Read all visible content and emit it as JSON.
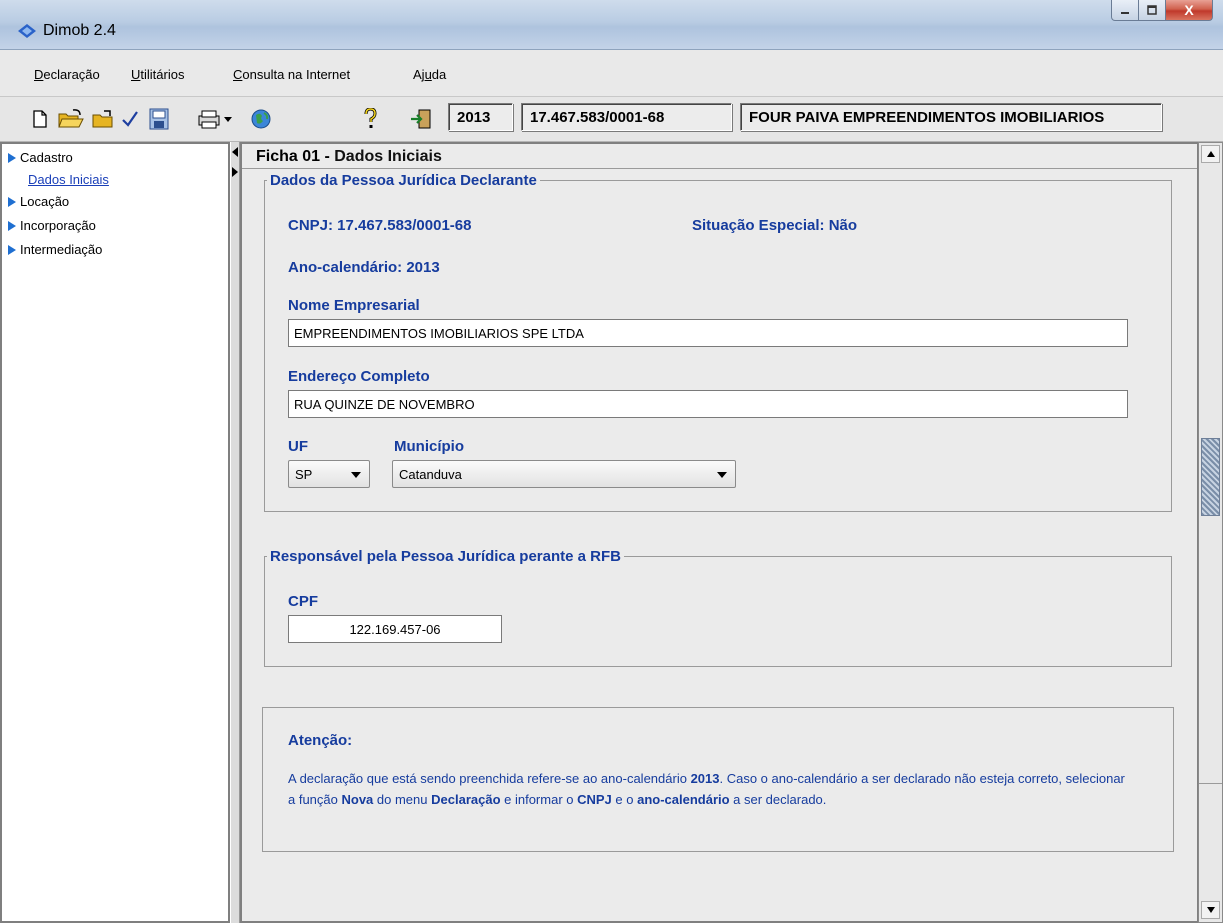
{
  "window": {
    "title": "Dimob 2.4",
    "close_glyph": "X"
  },
  "menu": {
    "items": [
      {
        "underline": "D",
        "rest": "eclaração"
      },
      {
        "underline": "U",
        "rest": "tilitários"
      },
      {
        "underline": "C",
        "rest": "onsulta na Internet"
      },
      {
        "underline": "",
        "rest": "Aj",
        "underline_mid": "u",
        "rest2": "da"
      }
    ]
  },
  "toolbar": {
    "icons": [
      "new-icon",
      "open-folder-icon",
      "open-icon",
      "check-icon",
      "save-icon",
      "printer-icon",
      "globe-icon",
      "help-icon",
      "exit-icon"
    ],
    "year": "2013",
    "cnpj": "17.467.583/0001-68",
    "company": "FOUR PAIVA EMPREENDIMENTOS IMOBILIARIOS"
  },
  "sidebar": {
    "items": [
      {
        "label": "Cadastro"
      },
      {
        "label": "Dados Iniciais"
      },
      {
        "label": "Locação"
      },
      {
        "label": "Incorporação"
      },
      {
        "label": "Intermediação"
      }
    ]
  },
  "ficha": {
    "title_prefix": "Ficha 01",
    "title_sep": " - ",
    "title_name": "Dados Iniciais"
  },
  "declarante": {
    "legend": "Dados da Pessoa Jurídica Declarante",
    "cnpj_label": "CNPJ: 17.467.583/0001-68",
    "situacao_label": "Situação Especial: Não",
    "ano_label": "Ano-calendário: 2013",
    "nome_label": "Nome Empresarial",
    "nome_value": "EMPREENDIMENTOS IMOBILIARIOS SPE LTDA",
    "endereco_label": "Endereço Completo",
    "endereco_value": "RUA QUINZE DE NOVEMBRO",
    "uf_label": "UF",
    "uf_value": "SP",
    "municipio_label": "Município",
    "municipio_value": "Catanduva"
  },
  "responsavel": {
    "legend": "Responsável pela Pessoa Jurídica perante a RFB",
    "cpf_label": "CPF",
    "cpf_value": "122.169.457-06"
  },
  "atencao": {
    "title": "Atenção:",
    "t1": "A declaração que está sendo preenchida refere-se ao ano-calendário ",
    "b1": "2013",
    "t2": ". Caso o ano-calendário a ser declarado não esteja correto, selecionar a função ",
    "b2": "Nova",
    "t3": " do menu ",
    "b3": "Declaração",
    "t4": " e informar o ",
    "b4": "CNPJ",
    "t5": " e o ",
    "b5": "ano-calendário",
    "t6": " a ser declarado."
  },
  "colors": {
    "label_blue": "#163c9e",
    "link_blue": "#1a3fb8",
    "tree_arrow": "#1f6fd1",
    "close_red": "#c0392b"
  }
}
